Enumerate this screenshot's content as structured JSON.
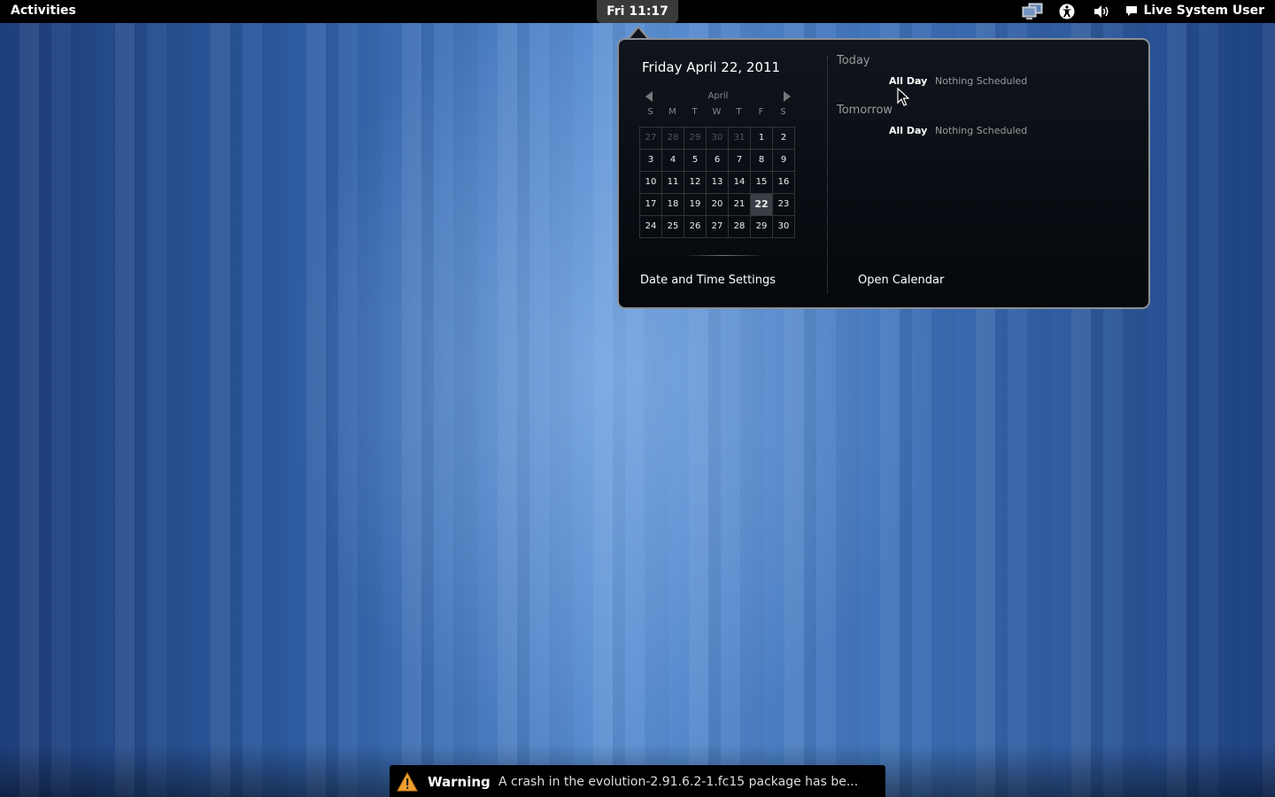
{
  "top_panel": {
    "activities_label": "Activities",
    "clock_label": "Fri 11:17",
    "user_label": "Live System User"
  },
  "tray_icons": [
    "network-icon",
    "accessibility-icon",
    "volume-icon",
    "chat-icon"
  ],
  "calendar_popup": {
    "date_header": "Friday April 22, 2011",
    "month_label": "April",
    "weekdays": [
      "S",
      "M",
      "T",
      "W",
      "T",
      "F",
      "S"
    ],
    "weeks": [
      [
        {
          "d": "27",
          "other": true
        },
        {
          "d": "28",
          "other": true
        },
        {
          "d": "29",
          "other": true
        },
        {
          "d": "30",
          "other": true
        },
        {
          "d": "31",
          "other": true
        },
        {
          "d": "1"
        },
        {
          "d": "2"
        }
      ],
      [
        {
          "d": "3"
        },
        {
          "d": "4"
        },
        {
          "d": "5"
        },
        {
          "d": "6"
        },
        {
          "d": "7"
        },
        {
          "d": "8"
        },
        {
          "d": "9"
        }
      ],
      [
        {
          "d": "10"
        },
        {
          "d": "11"
        },
        {
          "d": "12"
        },
        {
          "d": "13"
        },
        {
          "d": "14"
        },
        {
          "d": "15"
        },
        {
          "d": "16"
        }
      ],
      [
        {
          "d": "17"
        },
        {
          "d": "18"
        },
        {
          "d": "19"
        },
        {
          "d": "20"
        },
        {
          "d": "21"
        },
        {
          "d": "22",
          "today": true
        },
        {
          "d": "23"
        }
      ],
      [
        {
          "d": "24"
        },
        {
          "d": "25"
        },
        {
          "d": "26"
        },
        {
          "d": "27"
        },
        {
          "d": "28"
        },
        {
          "d": "29"
        },
        {
          "d": "30"
        }
      ]
    ],
    "settings_link": "Date and Time Settings",
    "open_calendar_link": "Open Calendar",
    "today": {
      "header": "Today",
      "event_time": "All Day",
      "event_text": "Nothing Scheduled"
    },
    "tomorrow": {
      "header": "Tomorrow",
      "event_time": "All Day",
      "event_text": "Nothing Scheduled"
    }
  },
  "notification": {
    "title": "Warning",
    "text": "A crash in the evolution-2.91.6.2-1.fc15 package has be...",
    "warning_color": "#f0a030"
  }
}
